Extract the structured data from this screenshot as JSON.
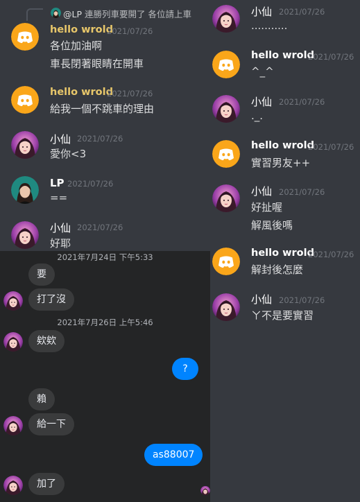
{
  "left": {
    "reply": {
      "mention": "@LP",
      "text": "連勝列車要開了 各位請上車"
    },
    "messages": [
      {
        "author": "hello wrold",
        "time": "2021/07/26",
        "lines": [
          "各位加油啊",
          "車長閉著眼睛在開車"
        ]
      },
      {
        "author": "hello wrold",
        "time": "2021/07/26",
        "lines": [
          "給我一個不跳車的理由"
        ]
      },
      {
        "author": "小仙",
        "time": "2021/07/26",
        "lines": [
          "愛你<3"
        ]
      },
      {
        "author": "LP",
        "time": "2021/07/26",
        "lines": [
          "=="
        ]
      },
      {
        "author": "小仙",
        "time": "2021/07/26",
        "lines": [
          "好耶"
        ]
      }
    ]
  },
  "right": {
    "messages": [
      {
        "author": "小仙",
        "time": "2021/07/26",
        "lines": [
          "..........."
        ]
      },
      {
        "author": "hello wrold",
        "time": "2021/07/26",
        "lines": [
          "^_^"
        ]
      },
      {
        "author": "小仙",
        "time": "2021/07/26",
        "lines": [
          "._."
        ]
      },
      {
        "author": "hello wrold",
        "time": "2021/07/26",
        "lines": [
          "實習男友++"
        ]
      },
      {
        "author": "小仙",
        "time": "2021/07/26",
        "lines": [
          "好扯喔",
          "解風後嗎"
        ]
      },
      {
        "author": "hello wrold",
        "time": "2021/07/26",
        "lines": [
          "解封後怎麼"
        ]
      },
      {
        "author": "小仙",
        "time": "2021/07/26",
        "lines": [
          "ㄚ不是要實習"
        ]
      }
    ]
  },
  "messenger": {
    "separators": [
      "2021年7月24日 下午5:33",
      "2021年7月26日 上午5:46"
    ],
    "bubbles": [
      "要",
      "打了沒",
      "欸欸",
      "?",
      "賴",
      "給一下",
      "as88007",
      "加了"
    ]
  },
  "colors": {
    "discord_bg": "#36393f",
    "bot_name": "#e8c76a",
    "discord_blurple": "#f9a62b",
    "messenger_blue": "#0084ff",
    "messenger_bg": "#242526"
  }
}
